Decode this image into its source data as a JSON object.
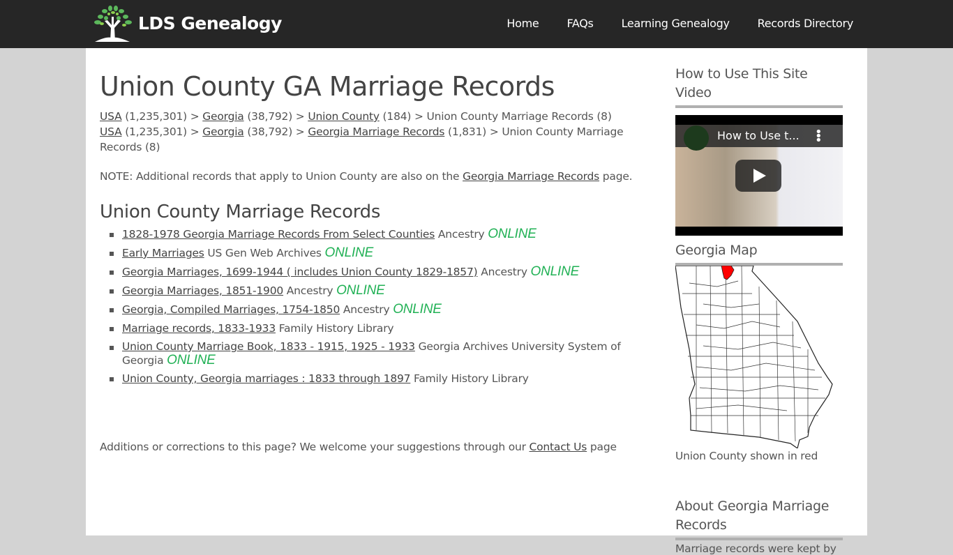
{
  "header": {
    "logo_text": "LDS Genealogy",
    "nav": [
      {
        "label": "Home"
      },
      {
        "label": "FAQs"
      },
      {
        "label": "Learning Genealogy"
      },
      {
        "label": "Records Directory"
      }
    ]
  },
  "main": {
    "title": "Union County GA Marriage Records",
    "breadcrumbs": [
      {
        "items": [
          {
            "link": "USA",
            "count": " (1,235,301) > "
          },
          {
            "link": "Georgia",
            "count": " (38,792) > "
          },
          {
            "link": "Union County",
            "count": " (184) > "
          }
        ],
        "current": "Union County Marriage Records (8)"
      },
      {
        "items": [
          {
            "link": "USA",
            "count": " (1,235,301) > "
          },
          {
            "link": "Georgia",
            "count": " (38,792) > "
          },
          {
            "link": "Georgia Marriage Records",
            "count": " (1,831) > "
          }
        ],
        "current": "Union County Marriage Records (8)"
      }
    ],
    "note": {
      "prefix": "NOTE: Additional records that apply to Union County are also on the ",
      "link": "Georgia Marriage Records",
      "suffix": " page."
    },
    "section_title": "Union County Marriage Records",
    "records": [
      {
        "title": "1828-1978 Georgia Marriage Records From Select Counties",
        "source": " Ancestry ",
        "online": "ONLINE"
      },
      {
        "title": "Early Marriages",
        "source": " US Gen Web Archives ",
        "online": "ONLINE"
      },
      {
        "title": "Georgia Marriages, 1699-1944 ( includes Union County 1829-1857)",
        "source": " Ancestry ",
        "online": "ONLINE"
      },
      {
        "title": "Georgia Marriages, 1851-1900",
        "source": " Ancestry ",
        "online": "ONLINE"
      },
      {
        "title": "Georgia, Compiled Marriages, 1754-1850",
        "source": " Ancestry ",
        "online": "ONLINE"
      },
      {
        "title": "Marriage records, 1833-1933",
        "source": " Family History Library",
        "online": null
      },
      {
        "title": "Union County Marriage Book, 1833 - 1915, 1925 - 1933",
        "source": " Georgia Archives University System of Georgia ",
        "online": "ONLINE"
      },
      {
        "title": "Union County, Georgia marriages : 1833 through 1897",
        "source": " Family History Library",
        "online": null
      }
    ],
    "footer": {
      "prefix": "Additions or corrections to this page? We welcome your suggestions through our ",
      "link": "Contact Us",
      "suffix": " page"
    }
  },
  "sidebar": {
    "video_heading": "How to Use This Site Video",
    "video_title": "How to Use t...",
    "map_heading": "Georgia Map",
    "map_caption": "Union County shown in red",
    "highlight_color": "#ff0000",
    "about_heading": "About Georgia Marriage Records",
    "about_text": "Marriage records were kept by"
  },
  "colors": {
    "topbar": "#262626",
    "online": "#21b155",
    "background": "#d3d3d3"
  }
}
